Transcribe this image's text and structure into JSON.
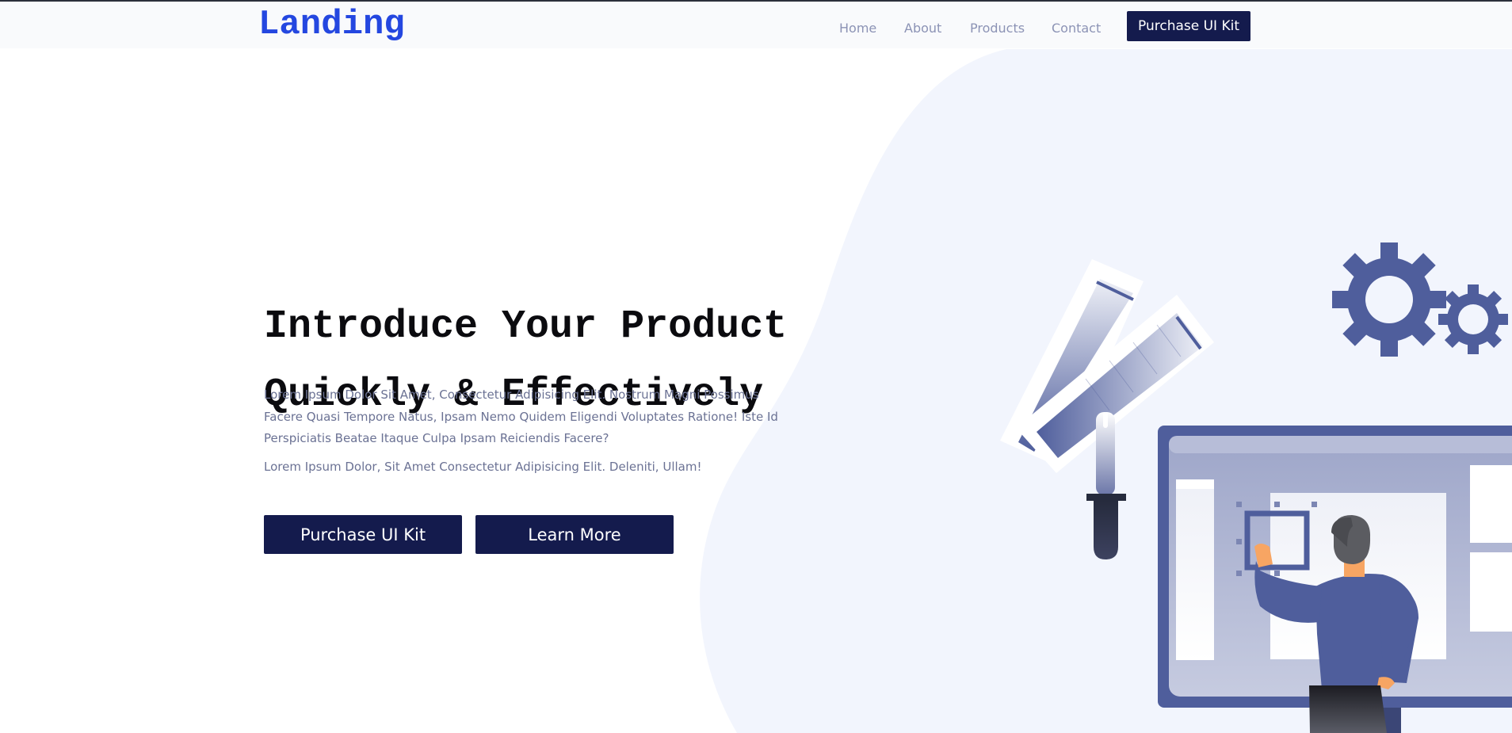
{
  "nav": {
    "logo": "Landing",
    "links": [
      "Home",
      "About",
      "Products",
      "Contact"
    ],
    "cta_label": "Purchase UI Kit"
  },
  "hero": {
    "title_line1": "Introduce Your Product",
    "title_line2": "Quickly & Effectively",
    "description": "Lorem Ipsum Dolor Sit Amet, Consectetur Adipisicing Elit. Nostrum Magni Possimus Facere Quasi Tempore Natus, Ipsam Nemo Quidem Eligendi Voluptates Ratione! Iste Id Perspiciatis Beatae Itaque Culpa Ipsam Reiciendis Facere?",
    "subtext": "Lorem Ipsum Dolor, Sit Amet Consectetur Adipisicing Elit. Deleniti, Ullam!",
    "primary_button": "Purchase UI Kit",
    "secondary_button": "Learn More"
  },
  "colors": {
    "accent": "#2447e0",
    "button_bg": "#141b4d",
    "illustration": "#4f5e9c",
    "blob": "#f2f5fd"
  },
  "illustration": {
    "items": [
      "color-swatch",
      "dropper",
      "gears",
      "monitor",
      "person"
    ]
  }
}
